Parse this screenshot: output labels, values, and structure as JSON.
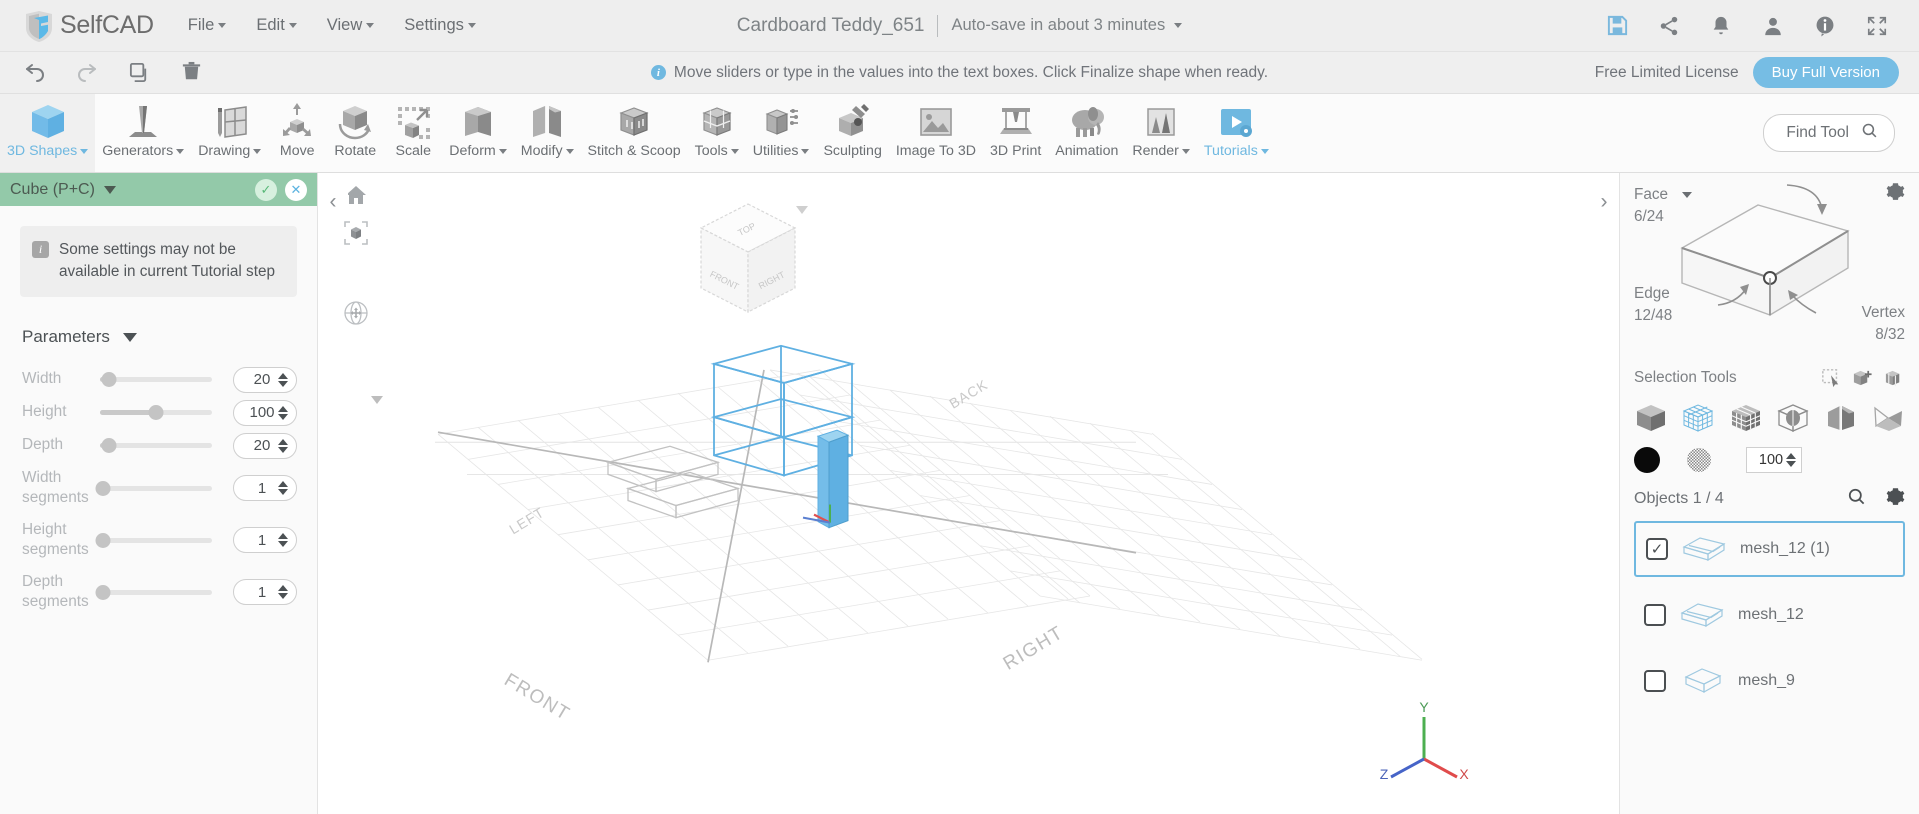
{
  "app": {
    "brand": "SelfCAD",
    "menu": [
      {
        "label": "File",
        "has_caret": true
      },
      {
        "label": "Edit",
        "has_caret": true
      },
      {
        "label": "View",
        "has_caret": true
      },
      {
        "label": "Settings",
        "has_caret": true
      }
    ],
    "document_title": "Cardboard Teddy_651",
    "autosave_text": "Auto-save in about 3 minutes",
    "top_icons": [
      {
        "name": "save-icon",
        "glyph": "save"
      },
      {
        "name": "share-icon",
        "glyph": "share"
      },
      {
        "name": "notifications-bell-icon",
        "glyph": "bell"
      },
      {
        "name": "user-account-icon",
        "glyph": "user"
      },
      {
        "name": "info-icon",
        "glyph": "info"
      },
      {
        "name": "fullscreen-icon",
        "glyph": "fullscreen"
      }
    ]
  },
  "notifbar": {
    "undo_label": "undo",
    "redo_label": "redo",
    "copy_label": "copy",
    "delete_label": "delete",
    "message": "Move sliders or type in the values into the text boxes. Click Finalize shape when ready.",
    "info_badge": "i",
    "license_text": "Free Limited License",
    "buy_label": "Buy Full Version"
  },
  "ribbon": {
    "items": [
      {
        "label": "3D Shapes",
        "icon": "cube-blue-icon",
        "caret": true,
        "active": true,
        "blue": true
      },
      {
        "label": "Generators",
        "icon": "generator-cone-icon",
        "caret": true,
        "active": false,
        "blue": false
      },
      {
        "label": "Drawing",
        "icon": "drawing-pencil-icon",
        "caret": true,
        "active": false,
        "blue": false
      },
      {
        "label": "Move",
        "icon": "move-arrows-icon",
        "caret": false,
        "active": false,
        "blue": false
      },
      {
        "label": "Rotate",
        "icon": "rotate-cube-icon",
        "caret": false,
        "active": false,
        "blue": false
      },
      {
        "label": "Scale",
        "icon": "scale-cube-icon",
        "caret": false,
        "active": false,
        "blue": false
      },
      {
        "label": "Deform",
        "icon": "deform-cube-icon",
        "caret": true,
        "active": false,
        "blue": false
      },
      {
        "label": "Modify",
        "icon": "modify-cube-icon",
        "caret": true,
        "active": false,
        "blue": false
      },
      {
        "label": "Stitch & Scoop",
        "icon": "stitch-scoop-icon",
        "caret": false,
        "active": false,
        "blue": false
      },
      {
        "label": "Tools",
        "icon": "tools-cube-icon",
        "caret": true,
        "active": false,
        "blue": false
      },
      {
        "label": "Utilities",
        "icon": "utilities-icon",
        "caret": true,
        "active": false,
        "blue": false
      },
      {
        "label": "Sculpting",
        "icon": "sculpting-brush-icon",
        "caret": false,
        "active": false,
        "blue": false
      },
      {
        "label": "Image To 3D",
        "icon": "image-to-3d-icon",
        "caret": false,
        "active": false,
        "blue": false
      },
      {
        "label": "3D Print",
        "icon": "3d-printer-icon",
        "caret": false,
        "active": false,
        "blue": false
      },
      {
        "label": "Animation",
        "icon": "animation-elephant-icon",
        "caret": false,
        "active": false,
        "blue": false
      },
      {
        "label": "Render",
        "icon": "render-icon",
        "caret": true,
        "active": false,
        "blue": false
      },
      {
        "label": "Tutorials",
        "icon": "tutorials-play-icon",
        "caret": true,
        "active": false,
        "blue": true
      }
    ]
  },
  "find_tool": {
    "placeholder": "Find Tool",
    "icon": "search-icon"
  },
  "left_panel": {
    "header_title": "Cube (P+C)",
    "confirm_label": "✓",
    "cancel_label": "✕",
    "notice": "Some settings may not be available in current Tutorial step",
    "notice_badge": "i",
    "params_title": "Parameters",
    "parameters": [
      {
        "label": "Width",
        "value": "20",
        "fill_pct": 8
      },
      {
        "label": "Height",
        "value": "100",
        "fill_pct": 50
      },
      {
        "label": "Depth",
        "value": "20",
        "fill_pct": 8
      },
      {
        "label": "Width segments",
        "value": "1",
        "fill_pct": 0
      },
      {
        "label": "Height segments",
        "value": "1",
        "fill_pct": 0
      },
      {
        "label": "Depth segments",
        "value": "1",
        "fill_pct": 0
      }
    ]
  },
  "viewport": {
    "nav_cube_faces": {
      "top": "TOP",
      "front": "FRONT",
      "right": "RIGHT"
    },
    "ground_labels": {
      "left": "LEFT",
      "back": "BACK",
      "front": "FRONT",
      "right": "RIGHT"
    },
    "axis_labels": {
      "x": "X",
      "y": "Y",
      "z": "Z"
    },
    "tools": [
      {
        "name": "home-view-icon",
        "label": "home"
      },
      {
        "name": "fit-to-screen-icon",
        "label": "fit"
      },
      {
        "name": "orbit-navigation-icon",
        "label": "orbit"
      }
    ],
    "collapse_left": "‹",
    "collapse_right": "›"
  },
  "right_panel": {
    "mesh_info": {
      "face_label": "Face",
      "face_value": "6/24",
      "edge_label": "Edge",
      "edge_value": "12/48",
      "vertex_label": "Vertex",
      "vertex_value": "8/32"
    },
    "selection_tools_label": "Selection Tools",
    "selection_top_icons": [
      {
        "name": "rectangle-select-icon"
      },
      {
        "name": "add-selection-icon"
      },
      {
        "name": "invert-selection-icon"
      }
    ],
    "selection_modes": [
      {
        "name": "object-mode-icon",
        "active": false
      },
      {
        "name": "wireframe-mode-icon",
        "active": true
      },
      {
        "name": "face-mode-icon",
        "active": false
      },
      {
        "name": "sphere-select-icon",
        "active": false
      },
      {
        "name": "edge-mode-icon",
        "active": false
      },
      {
        "name": "polygon-mode-icon",
        "active": false
      }
    ],
    "color_swatch": "#0a0a0a",
    "texture_icon": "texture-ball-icon",
    "opacity_value": "100",
    "objects_label": "Objects 1 / 4",
    "objects_search_icon": "search-icon",
    "objects_settings_icon": "gear-icon",
    "objects": [
      {
        "name": "mesh_12 (1)",
        "checked": true,
        "selected": true
      },
      {
        "name": "mesh_12",
        "checked": false,
        "selected": false
      },
      {
        "name": "mesh_9",
        "checked": false,
        "selected": false
      }
    ]
  },
  "colors": {
    "accent_blue": "#6fb8e0",
    "panel_green": "#93c9a9",
    "bg_gray": "#efefef",
    "text_gray": "#6b6f73"
  }
}
